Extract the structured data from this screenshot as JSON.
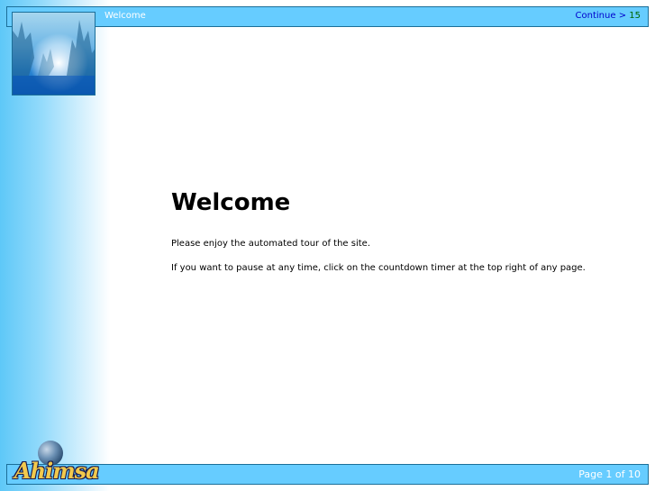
{
  "header": {
    "title": "Welcome",
    "continue_label": "Continue >",
    "countdown": "15"
  },
  "footer": {
    "page_indicator": "Page 1 of 10"
  },
  "brand": {
    "logo_text": "Ahimsa"
  },
  "main": {
    "heading": "Welcome",
    "paragraphs": [
      "Please enjoy the automated tour of the site.",
      "If you want to pause at any time, click on the countdown timer at the top right of any page."
    ]
  },
  "colors": {
    "bar": "#66ccff",
    "continue_link": "#0000cc",
    "countdown": "#006600"
  }
}
